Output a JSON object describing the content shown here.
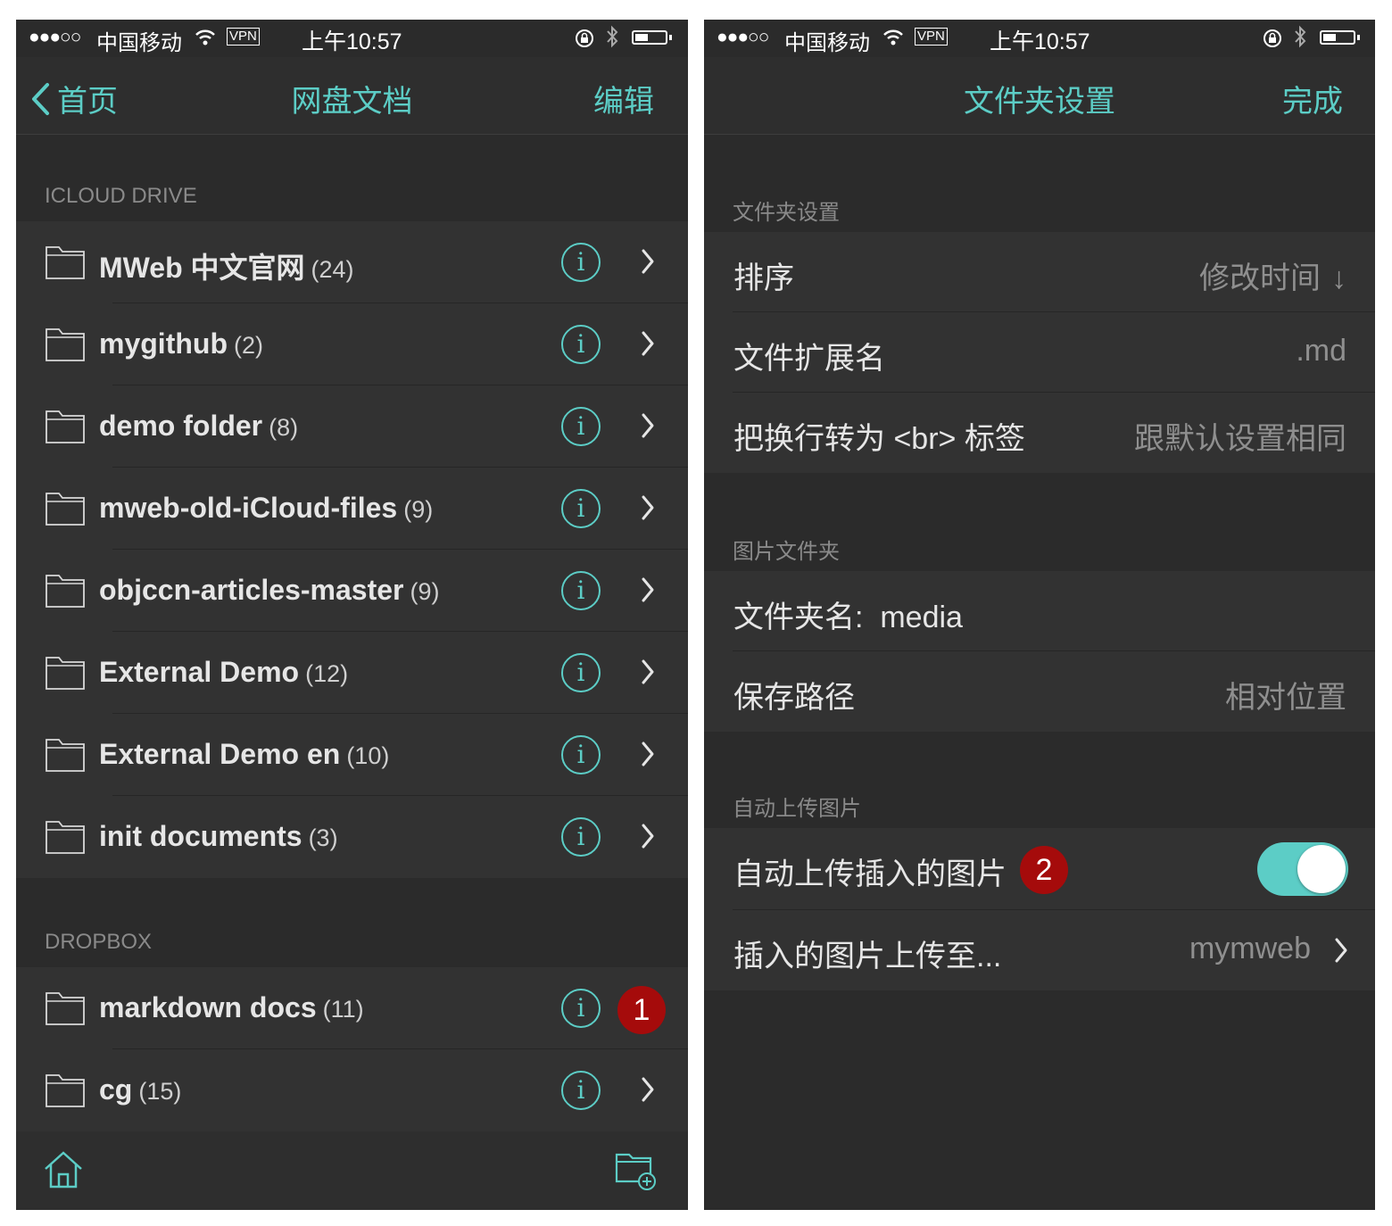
{
  "left": {
    "statusbar": {
      "signal": "●●●○○",
      "carrier": "中国移动",
      "vpn": "VPN",
      "time": "上午10:57"
    },
    "nav": {
      "back_label": "首页",
      "title": "网盘文档",
      "right_label": "编辑"
    },
    "sections": [
      {
        "header": "ICLOUD DRIVE",
        "items": [
          {
            "name": "MWeb 中文官网",
            "count": "(24)"
          },
          {
            "name": "mygithub",
            "count": "(2)"
          },
          {
            "name": "demo folder",
            "count": "(8)"
          },
          {
            "name": "mweb-old-iCloud-files",
            "count": "(9)"
          },
          {
            "name": "objccn-articles-master",
            "count": "(9)"
          },
          {
            "name": "External Demo",
            "count": "(12)"
          },
          {
            "name": "External Demo en",
            "count": "(10)"
          },
          {
            "name": "init documents",
            "count": "(3)"
          }
        ]
      },
      {
        "header": "DROPBOX",
        "items": [
          {
            "name": "markdown docs",
            "count": "(11)"
          },
          {
            "name": "cg",
            "count": "(15)"
          }
        ]
      }
    ],
    "info_glyph": "i",
    "badge": "1"
  },
  "right": {
    "statusbar": {
      "signal": "●●●○○",
      "carrier": "中国移动",
      "vpn": "VPN",
      "time": "上午10:57"
    },
    "nav": {
      "title": "文件夹设置",
      "right_label": "完成"
    },
    "folder_settings": {
      "header": "文件夹设置",
      "rows": [
        {
          "label": "排序",
          "value": "修改时间",
          "arrow": "↓"
        },
        {
          "label": "文件扩展名",
          "value": ".md"
        },
        {
          "label": "把换行转为 <br> 标签",
          "value": "跟默认设置相同"
        }
      ]
    },
    "image_folder": {
      "header": "图片文件夹",
      "rows": [
        {
          "label": "文件夹名:  media",
          "value": ""
        },
        {
          "label": "保存路径",
          "value": "相对位置"
        }
      ]
    },
    "auto_upload": {
      "header": "自动上传图片",
      "toggle_label": "自动上传插入的图片",
      "toggle_on": true,
      "upload_label": "插入的图片上传至...",
      "upload_value": "mymweb"
    },
    "badge": "2"
  },
  "colors": {
    "accent": "#5ccdc6",
    "background": "#2b2b2b",
    "row": "#323232",
    "badge": "#a50b0b"
  },
  "icons": [
    "folder-icon",
    "info-icon",
    "chevron-right-icon",
    "home-icon",
    "new-folder-icon",
    "wifi-icon",
    "lock-icon",
    "bluetooth-icon",
    "battery-icon",
    "chevron-left-icon"
  ]
}
